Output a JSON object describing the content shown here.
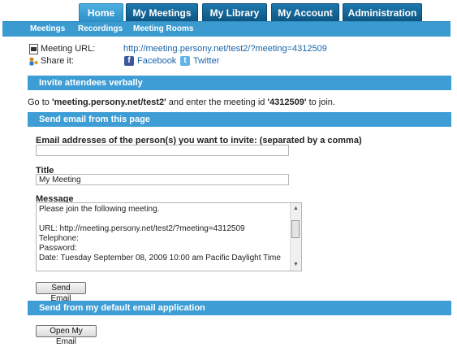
{
  "nav": {
    "tabs": [
      {
        "label": "Home",
        "active": true
      },
      {
        "label": "My Meetings"
      },
      {
        "label": "My Library"
      },
      {
        "label": "My Account"
      },
      {
        "label": "Administration"
      }
    ],
    "subnav": [
      "Meetings",
      "Recordings",
      "Meeting Rooms"
    ]
  },
  "meeting": {
    "url_label": "Meeting URL:",
    "url": "http://meeting.persony.net/test2/?meeting=4312509",
    "share_label": "Share it:",
    "facebook": "Facebook",
    "twitter": "Twitter"
  },
  "invite_verbal": {
    "header": "Invite attendees verbally",
    "text_go": "Go to ",
    "site": "'meeting.persony.net/test2'",
    "text_mid": " and enter the meeting id ",
    "meeting_id": "'4312509'",
    "text_end": " to join."
  },
  "send_email": {
    "header": "Send email from this page",
    "emails_label": "Email addresses of the person(s) you want to invite: (separated by a comma)",
    "emails_value": "",
    "title_label": "Title",
    "title_value": "My Meeting",
    "message_label": "Message",
    "message": "Please join the following meeting.\n\nURL: http://meeting.persony.net/test2/?meeting=4312509\nTelephone:\nPassword:\nDate: Tuesday September 08, 2009 10:00 am Pacific Daylight Time",
    "send_button": "Send Email"
  },
  "default_app": {
    "header": "Send from my default email application",
    "open_button": "Open My Email"
  },
  "colors": {
    "accent": "#3d9dd4",
    "tab_dark": "#0e5683",
    "link": "#1a64a8"
  }
}
